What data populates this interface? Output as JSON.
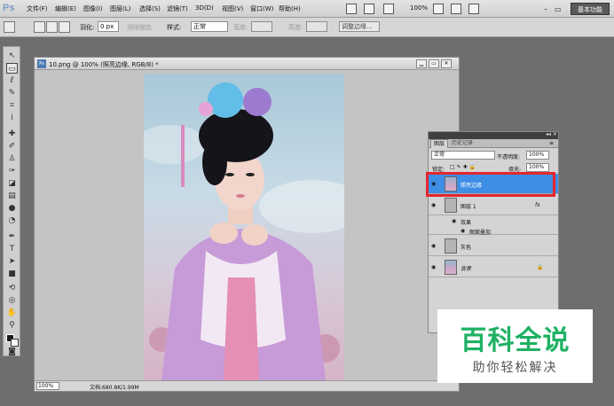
{
  "menubar": {
    "logo": "Ps",
    "items": [
      "文件(F)",
      "编辑(E)",
      "图像(I)",
      "图层(L)",
      "选择(S)",
      "滤镜(T)",
      "3D(D)",
      "视图(V)",
      "窗口(W)",
      "帮助(H)"
    ],
    "zoom": "100%",
    "workspace": "基本功能"
  },
  "optionsbar": {
    "feather_label": "羽化:",
    "feather_value": "0 px",
    "antialias_label": "消除锯齿",
    "style_label": "样式:",
    "style_value": "正常",
    "width_label": "宽度:",
    "height_label": "高度:",
    "refine_edge": "调整边缘..."
  },
  "document": {
    "title": "10.png @ 100% (照亮边缘, RGB/8) *",
    "zoom_field": "100%",
    "info": "文档:680.8K/1.99M"
  },
  "layers_panel": {
    "tab_layers": "图层",
    "tab_history": "历史记录",
    "blend_mode": "正常",
    "opacity_label": "不透明度:",
    "opacity_value": "100%",
    "lock_label": "锁定:",
    "fill_label": "填充:",
    "fill_value": "100%",
    "layers": [
      {
        "name": "照亮边缘"
      },
      {
        "name": "图层 1",
        "fx": "fx"
      },
      {
        "name": "灰色"
      },
      {
        "name": "背景"
      }
    ],
    "effects_label": "效果",
    "pattern_overlay_label": "图案叠加"
  },
  "watermark": {
    "title": "百科全说",
    "subtitle": "助你轻松解决"
  }
}
